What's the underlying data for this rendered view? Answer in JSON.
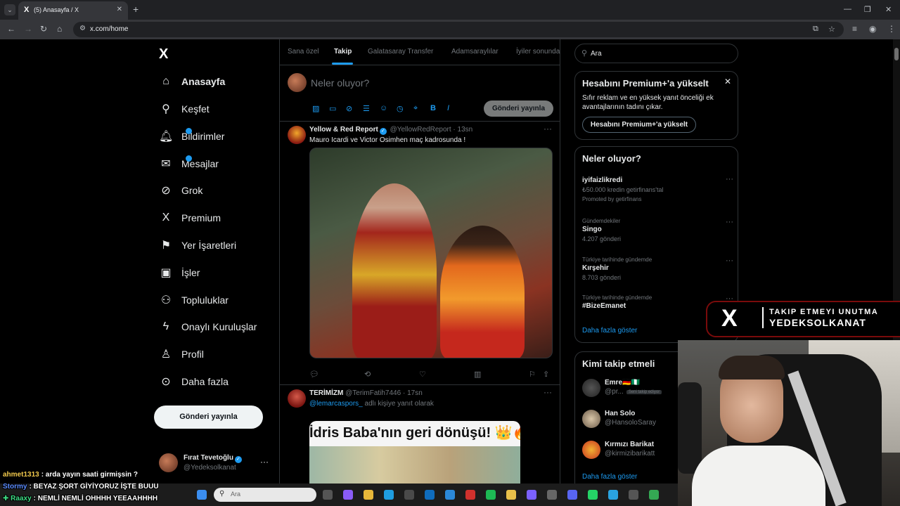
{
  "browser": {
    "tab_title": "(5) Anasayfa / X",
    "tab_favicon": "X",
    "url": "x.com/home"
  },
  "sidebar": {
    "logo": "X",
    "items": [
      {
        "label": "Anasayfa",
        "icon": "home-icon",
        "glyph": "⌂",
        "active": true
      },
      {
        "label": "Keşfet",
        "icon": "search-icon",
        "glyph": "⚲"
      },
      {
        "label": "Bildirimler",
        "icon": "bell-icon",
        "glyph": "🔔︎",
        "badge": ""
      },
      {
        "label": "Mesajlar",
        "icon": "mail-icon",
        "glyph": "✉",
        "badge": ""
      },
      {
        "label": "Grok",
        "icon": "grok-icon",
        "glyph": "⊘"
      },
      {
        "label": "Premium",
        "icon": "x-premium-icon",
        "glyph": "X"
      },
      {
        "label": "Yer İşaretleri",
        "icon": "bookmark-icon",
        "glyph": "⚑"
      },
      {
        "label": "İşler",
        "icon": "briefcase-icon",
        "glyph": "▣"
      },
      {
        "label": "Topluluklar",
        "icon": "communities-icon",
        "glyph": "⚇"
      },
      {
        "label": "Onaylı Kuruluşlar",
        "icon": "lightning-icon",
        "glyph": "ϟ"
      },
      {
        "label": "Profil",
        "icon": "profile-icon",
        "glyph": "♙"
      },
      {
        "label": "Daha fazla",
        "icon": "more-circle-icon",
        "glyph": "⊙"
      }
    ],
    "post_button": "Gönderi yayınla",
    "me": {
      "name": "Fırat Tevetoğlu",
      "handle": "@Yedeksolkanat"
    }
  },
  "feed": {
    "tabs": [
      "Sana özel",
      "Takip",
      "Galatasaray Transfer",
      "Adamsaraylılar",
      "İyiler sonunda"
    ],
    "active_tab": "Takip",
    "composer": {
      "placeholder": "Neler oluyor?",
      "send": "Gönderi yayınla"
    },
    "posts": [
      {
        "name": "Yellow & Red Report",
        "handle": "@YellowRedReport",
        "time": "· 13sn",
        "text": "Mauro Icardi ve Victor Osimhen maç kadrosunda !"
      },
      {
        "name": "TERİMİZM",
        "handle": "@TerimFatih7446",
        "time": "· 17sn",
        "reply_mention": "@lemarcaspors_",
        "reply_suffix": " adlı kişiye yanıt olarak",
        "image_caption": "İdris Baba'nın geri dönüşü! 👑🔥"
      }
    ]
  },
  "right": {
    "search_placeholder": "Ara",
    "premium": {
      "title": "Hesabını Premium+'a yükselt",
      "desc": "Sıfır reklam ve en yüksek yanıt önceliği ek avantajlarının tadını çıkar.",
      "button": "Hesabını Premium+'a yükselt"
    },
    "trends": {
      "title": "Neler oluyor?",
      "items": [
        {
          "context": "",
          "title": "iyifaizlikredi",
          "sub": "₺50.000 kredin getirfinans'tal",
          "sub2": "Promoted by getirfinans"
        },
        {
          "context": "Gündemdekiler",
          "title": "Singo",
          "sub": "4.207 gönderi"
        },
        {
          "context": "Türkiye tarihinde gündemde",
          "title": "Kırşehir",
          "sub": "8.703 gönderi"
        },
        {
          "context": "Türkiye tarihinde gündemde",
          "title": "#BizeEmanet",
          "sub": ""
        }
      ],
      "more": "Daha fazla göster"
    },
    "who_to_follow": {
      "title": "Kimi takip etmeli",
      "items": [
        {
          "name": "Emre🇩🇪🇳🇬",
          "handle": "@pr...",
          "badge": "Seni takip ediyor"
        },
        {
          "name": "Han Solo",
          "handle": "@HansoloSaray"
        },
        {
          "name": "Kırmızı Barikat",
          "handle": "@kirmizibarikatt"
        }
      ],
      "more": "Daha fazla göster"
    }
  },
  "overlay": {
    "line1": "TAKIP ETMEYI UNUTMA",
    "line2": "YEDEKSOLKANAT",
    "logo": "X"
  },
  "chat": [
    {
      "user": "ahmet1313",
      "msg": ": arda yayın saati girmişsin ?",
      "color": "#f2c94c"
    },
    {
      "user": "Stormy",
      "msg": ": BEYAZ ŞORT GİYİYORUZ İŞTE BUUU",
      "color": "#5b8cff"
    },
    {
      "user": "✚ Raaxy",
      "msg": ": NEMLİ NEMLİ OHHHH YEEAAHHHH",
      "color": "#3ddc84"
    }
  ],
  "taskbar": {
    "search_placeholder": "Ara"
  },
  "colors": {
    "accent": "#1d9bf0",
    "background": "#000000",
    "border": "#2f3336",
    "muted": "#71767b"
  }
}
